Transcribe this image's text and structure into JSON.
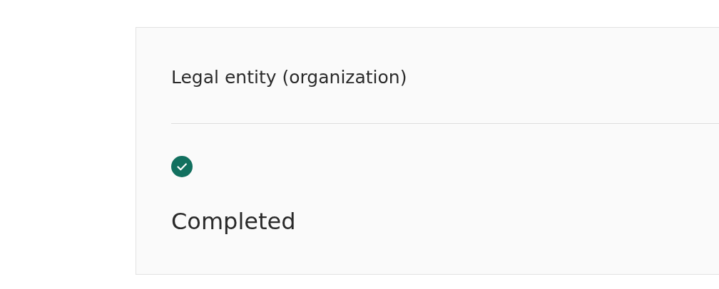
{
  "card": {
    "title": "Legal entity (organization)",
    "status": {
      "kind": "completed",
      "label": "Completed"
    }
  }
}
